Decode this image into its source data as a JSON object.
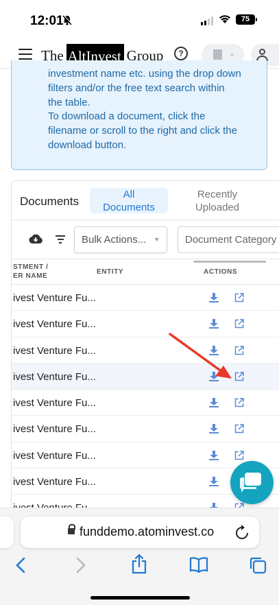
{
  "status_bar": {
    "time": "12:01",
    "battery": "75"
  },
  "header": {
    "logo_prefix": "The",
    "logo_mid": "AltInvest",
    "logo_suffix": "Group",
    "help_icon": "?"
  },
  "info_box": {
    "lines": [
      "investment name etc. using the drop down",
      "filters and/or the free text search within",
      "the table.",
      "To download a document, click the",
      "filename or scroll to the right and click the",
      "download button."
    ]
  },
  "documents": {
    "title": "Documents",
    "tab_all_line1": "All",
    "tab_all_line2": "Documents",
    "tab_recent_line1": "Recently",
    "tab_recent_line2": "Uploaded",
    "bulk_actions": "Bulk Actions...",
    "doc_category_placeholder": "Document Category",
    "columns": {
      "investment_line1": "STMENT /",
      "investment_line2": "ER NAME",
      "entity": "ENTITY",
      "actions": "ACTIONS"
    },
    "rows": [
      {
        "name": "ivest Venture Fu..."
      },
      {
        "name": "ivest Venture Fu..."
      },
      {
        "name": "ivest Venture Fu..."
      },
      {
        "name": "ivest Venture Fu..."
      },
      {
        "name": "ivest Venture Fu..."
      },
      {
        "name": "ivest Venture Fu..."
      },
      {
        "name": "ivest Venture Fu..."
      },
      {
        "name": "ivest Venture Fu..."
      },
      {
        "name": "ivest Venture Fu"
      }
    ]
  },
  "browser": {
    "url": "funddemo.atominvest.co"
  },
  "colors": {
    "accent_blue": "#1f78d1",
    "info_bg": "#e6f2fc",
    "chat_teal": "#14a4bf",
    "annotation_red": "#e8392b"
  },
  "icons": [
    "bell-slash-icon",
    "wifi-icon",
    "menu-icon",
    "help-icon",
    "building-icon",
    "user-icon",
    "cloud-download-icon",
    "filter-icon",
    "download-icon",
    "external-link-icon",
    "chat-icon",
    "lock-icon",
    "reload-icon",
    "back-icon",
    "forward-icon",
    "share-icon",
    "bookmarks-icon",
    "tabs-icon"
  ]
}
